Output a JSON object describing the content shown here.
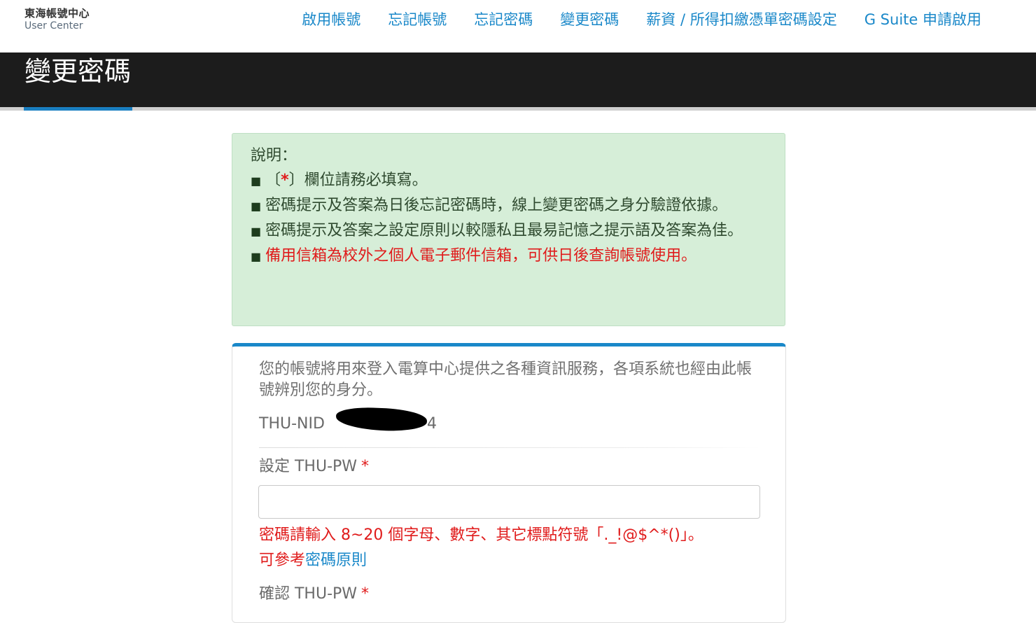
{
  "logo": {
    "zh": "東海帳號中心",
    "en": "User Center"
  },
  "nav": [
    "啟用帳號",
    "忘記帳號",
    "忘記密碼",
    "變更密碼",
    "薪資 / 所得扣繳憑單密碼設定",
    "G Suite 申請啟用"
  ],
  "page_title": "變更密碼",
  "notice": {
    "heading": "說明：",
    "bullet": "■",
    "item1_pre": "〔",
    "item1_star": "*",
    "item1_post": "〕欄位請務必填寫。",
    "item2": "密碼提示及答案為日後忘記密碼時，線上變更密碼之身分驗證依據。",
    "item3": "密碼提示及答案之設定原則以較隱私且最易記憶之提示語及答案為佳。",
    "item4": "備用信箱為校外之個人電子郵件信箱，可供日後查詢帳號使用。"
  },
  "form": {
    "intro": "您的帳號將用來登入電算中心提供之各種資訊服務，各項系統也經由此帳號辨別您的身分。",
    "nid_label": "THU-NID",
    "nid_tail": "4",
    "pw_label": "設定 THU-PW",
    "required_mark": "*",
    "pw_value": "",
    "hint_line1": "密碼請輸入 8~20 個字母、數字、其它標點符號「._!@$^*()」。",
    "hint_prefix": "可參考",
    "hint_link": "密碼原則",
    "confirm_label": "確認 THU-PW"
  }
}
